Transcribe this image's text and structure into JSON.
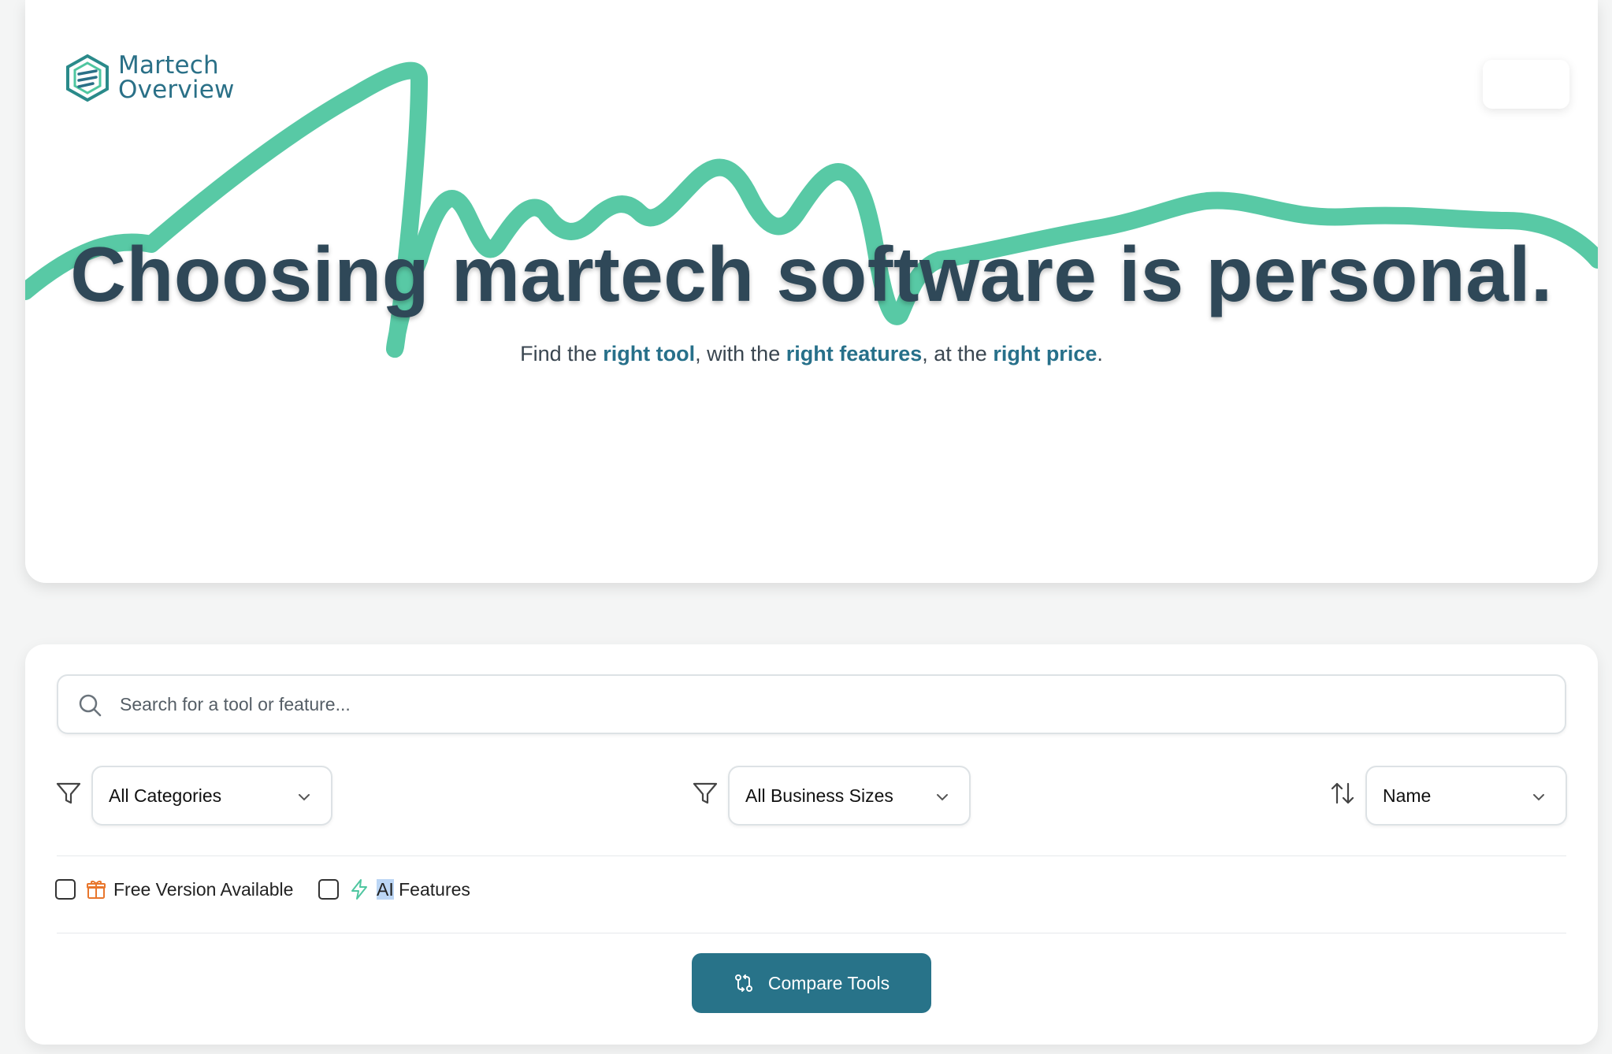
{
  "brand": {
    "name_line1": "Martech",
    "name_line2": "Overview",
    "color": "#2a7087",
    "accent": "#4fc6a0"
  },
  "header": {
    "menu_button_label": ""
  },
  "hero": {
    "title": "Choosing martech software is personal.",
    "subtitle": {
      "part1": "Find the ",
      "em1": "right tool",
      "part2": ", with the ",
      "em2": "right features",
      "part3": ", at the ",
      "em3": "right price",
      "part4": "."
    }
  },
  "search": {
    "placeholder": "Search for a tool or feature...",
    "value": ""
  },
  "filters": {
    "category": {
      "selected": "All Categories",
      "icon": "filter-icon"
    },
    "business_size": {
      "selected": "All Business Sizes",
      "icon": "filter-icon"
    },
    "sort": {
      "selected": "Name",
      "icon": "sort-arrows-icon"
    }
  },
  "toggles": {
    "free_version": {
      "label": "Free Version Available",
      "checked": false,
      "icon": "gift-icon",
      "icon_color": "#e8762c"
    },
    "ai_features": {
      "label_highlight": "AI",
      "label_rest": " Features",
      "checked": false,
      "icon": "lightning-icon",
      "icon_color": "#4fc6a0"
    }
  },
  "actions": {
    "compare_label": "Compare Tools",
    "compare_color": "#287389"
  }
}
